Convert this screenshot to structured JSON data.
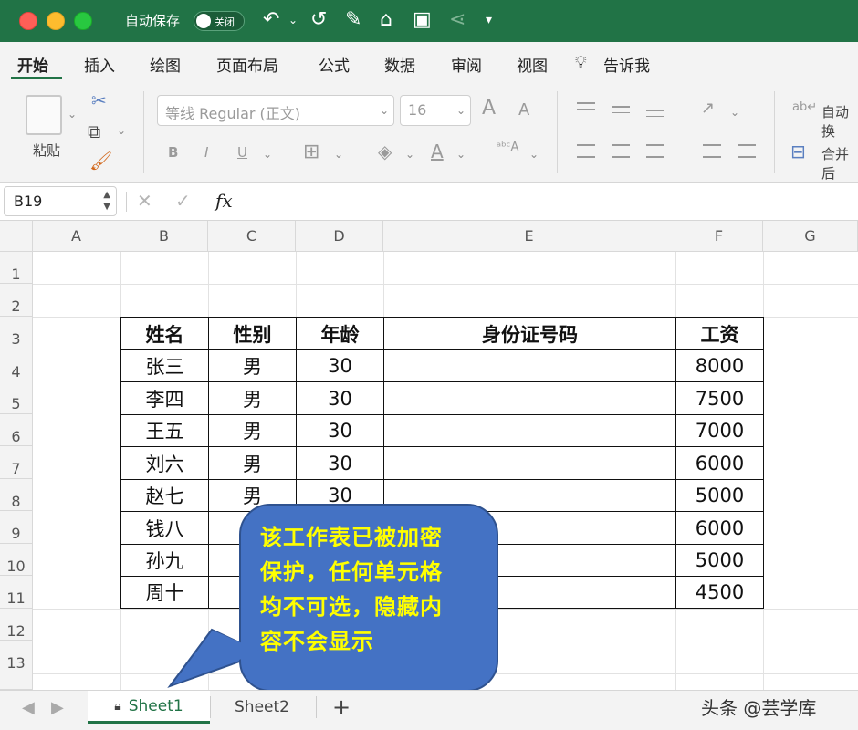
{
  "titlebar": {
    "autosave_label": "自动保存",
    "toggle_text": "关闭",
    "colors": {
      "bar": "#217346"
    }
  },
  "ribbon_tabs": [
    "开始",
    "插入",
    "绘图",
    "页面布局",
    "公式",
    "数据",
    "审阅",
    "视图",
    "告诉我"
  ],
  "ribbon": {
    "paste_label": "粘贴",
    "font_name": "等线 Regular (正文)",
    "font_size": "16",
    "bold": "B",
    "italic": "I",
    "underline": "U",
    "grow_font": "A",
    "shrink_font": "A",
    "font_color_letter": "A",
    "wrap_text": "自动换",
    "merge_center": "合并后"
  },
  "formula_bar": {
    "name_box": "B19",
    "cancel": "✕",
    "enter": "✓",
    "fx": "fx",
    "formula": ""
  },
  "columns": [
    "A",
    "B",
    "C",
    "D",
    "E",
    "F",
    "G"
  ],
  "rows": [
    "1",
    "2",
    "3",
    "4",
    "5",
    "6",
    "7",
    "8",
    "9",
    "10",
    "11",
    "12",
    "13"
  ],
  "table": {
    "headers": [
      "姓名",
      "性别",
      "年龄",
      "身份证号码",
      "工资"
    ],
    "rows": [
      [
        "张三",
        "男",
        "30",
        "",
        "8000"
      ],
      [
        "李四",
        "男",
        "30",
        "",
        "7500"
      ],
      [
        "王五",
        "男",
        "30",
        "",
        "7000"
      ],
      [
        "刘六",
        "男",
        "30",
        "",
        "6000"
      ],
      [
        "赵七",
        "男",
        "30",
        "",
        "5000"
      ],
      [
        "钱八",
        "",
        "",
        "",
        "6000"
      ],
      [
        "孙九",
        "",
        "",
        "",
        "5000"
      ],
      [
        "周十",
        "",
        "",
        "",
        "4500"
      ]
    ]
  },
  "callout": {
    "text_lines": [
      "该工作表已被加密",
      "保护，任何单元格",
      "均不可选，隐藏内",
      "容不会显示"
    ],
    "colors": {
      "fill": "#4472c4",
      "text": "#ffff00"
    }
  },
  "sheets": {
    "tabs": [
      "Sheet1",
      "Sheet2"
    ],
    "active": "Sheet1",
    "add_label": "+"
  },
  "watermark": "头条 @芸学库"
}
